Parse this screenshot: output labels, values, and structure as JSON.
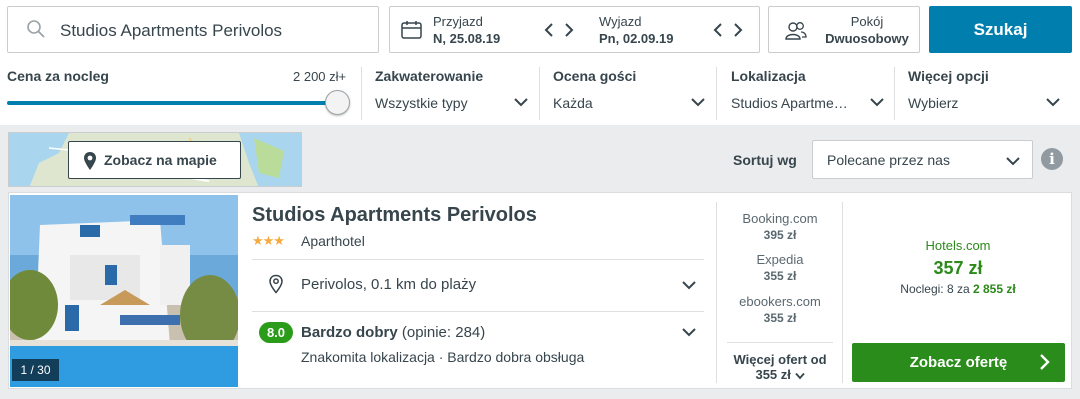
{
  "search": {
    "query": "Studios Apartments Perivolos",
    "button": "Szukaj"
  },
  "dates": {
    "checkin_label": "Przyjazd",
    "checkin_value": "N, 25.08.19",
    "checkout_label": "Wyjazd",
    "checkout_value": "Pn, 02.09.19"
  },
  "room": {
    "label": "Pokój",
    "value": "Dwuosobowy"
  },
  "filters": {
    "price": {
      "label": "Cena za nocleg",
      "max": "2 200 zł+",
      "level": 1.0
    },
    "accommodation": {
      "label": "Zakwaterowanie",
      "value": "Wszystkie typy"
    },
    "rating": {
      "label": "Ocena gości",
      "value": "Każda"
    },
    "location": {
      "label": "Lokalizacja",
      "value": "Studios Apartme…"
    },
    "more": {
      "label": "Więcej opcji",
      "value": "Wybierz"
    }
  },
  "map_button": "Zobacz na mapie",
  "sort": {
    "label": "Sortuj wg",
    "value": "Polecane przez nas",
    "info": "i"
  },
  "hotel": {
    "name": "Studios Apartments Perivolos",
    "stars": "★★★",
    "type": "Aparthotel",
    "photo_counter": "1 / 30",
    "location": "Perivolos, 0.1 km do plaży",
    "rating_score": "8.0",
    "rating_label": "Bardzo dobry",
    "rating_count": "(opinie: 284)",
    "rating_desc": "Znakomita lokalizacja · Bardzo dobra obsługa"
  },
  "offers": [
    {
      "provider": "Booking.com",
      "price": "395 zł"
    },
    {
      "provider": "Expedia",
      "price": "355 zł"
    },
    {
      "provider": "ebookers.com",
      "price": "355 zł"
    }
  ],
  "more_offers": {
    "line1": "Więcej ofert od",
    "line2": "355 zł"
  },
  "best_offer": {
    "provider": "Hotels.com",
    "price": "357 zł",
    "nights_text": "Noclegi: 8 za",
    "nights_total": "2 855 zł",
    "button": "Zobacz ofertę"
  },
  "colors": {
    "primary": "#007faf",
    "green": "#2a8c1a",
    "star": "#f6ab3f"
  }
}
